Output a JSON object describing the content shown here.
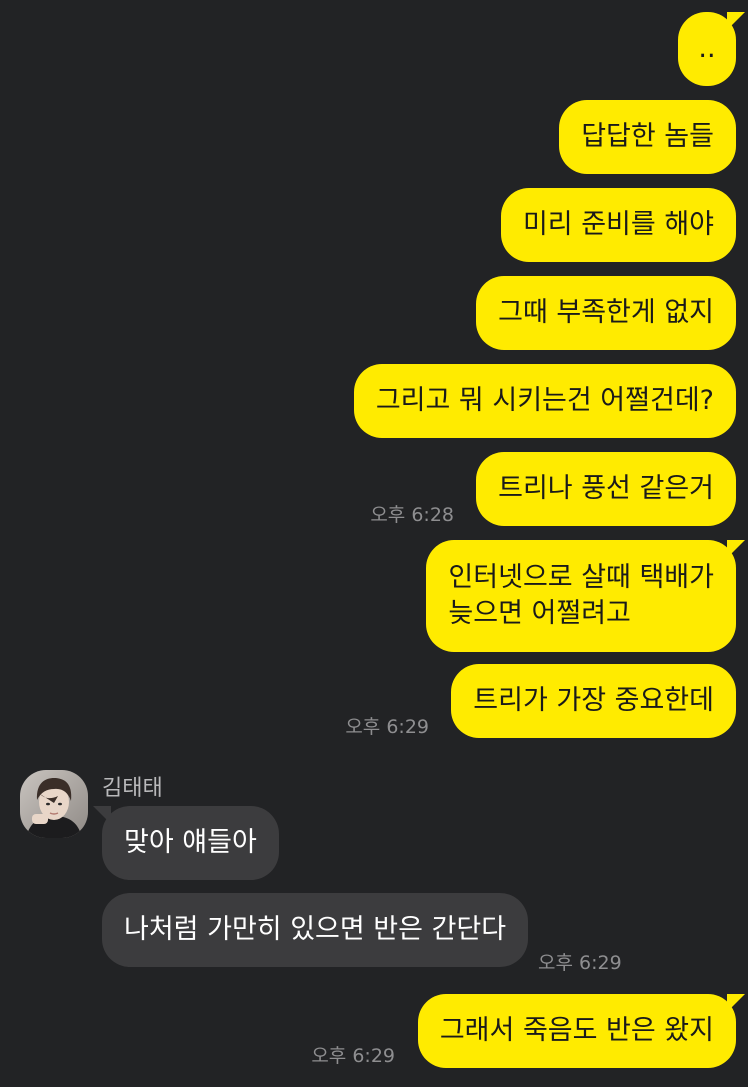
{
  "chat": {
    "sender_name": "김태태",
    "messages": [
      {
        "from": "me",
        "text": ".."
      },
      {
        "from": "me",
        "text": "답답한 놈들"
      },
      {
        "from": "me",
        "text": "미리 준비를 해야"
      },
      {
        "from": "me",
        "text": "그때 부족한게 없지"
      },
      {
        "from": "me",
        "text": "그리고 뭐 시키는건 어쩔건데?"
      },
      {
        "from": "me",
        "text": "트리나 풍선 같은거",
        "time": "오후 6:28"
      },
      {
        "from": "me",
        "text_line1": "인터넷으로 살때 택배가",
        "text_line2": "늦으면 어쩔려고"
      },
      {
        "from": "me",
        "text": "트리가 가장 중요한데",
        "time": "오후 6:29"
      },
      {
        "from": "김태태",
        "text": "맞아 얘들아"
      },
      {
        "from": "김태태",
        "text": "나처럼 가만히 있으면 반은 간단다",
        "time": "오후 6:29"
      },
      {
        "from": "me",
        "text": "그래서 죽음도 반은 왔지",
        "time": "오후 6:29"
      }
    ]
  },
  "colors": {
    "background": "#222325",
    "my_bubble": "#FFEB00",
    "their_bubble": "#3C3C3E",
    "timestamp": "#8E8E90"
  },
  "icons": {
    "avatar": "profile-photo-avatar"
  }
}
